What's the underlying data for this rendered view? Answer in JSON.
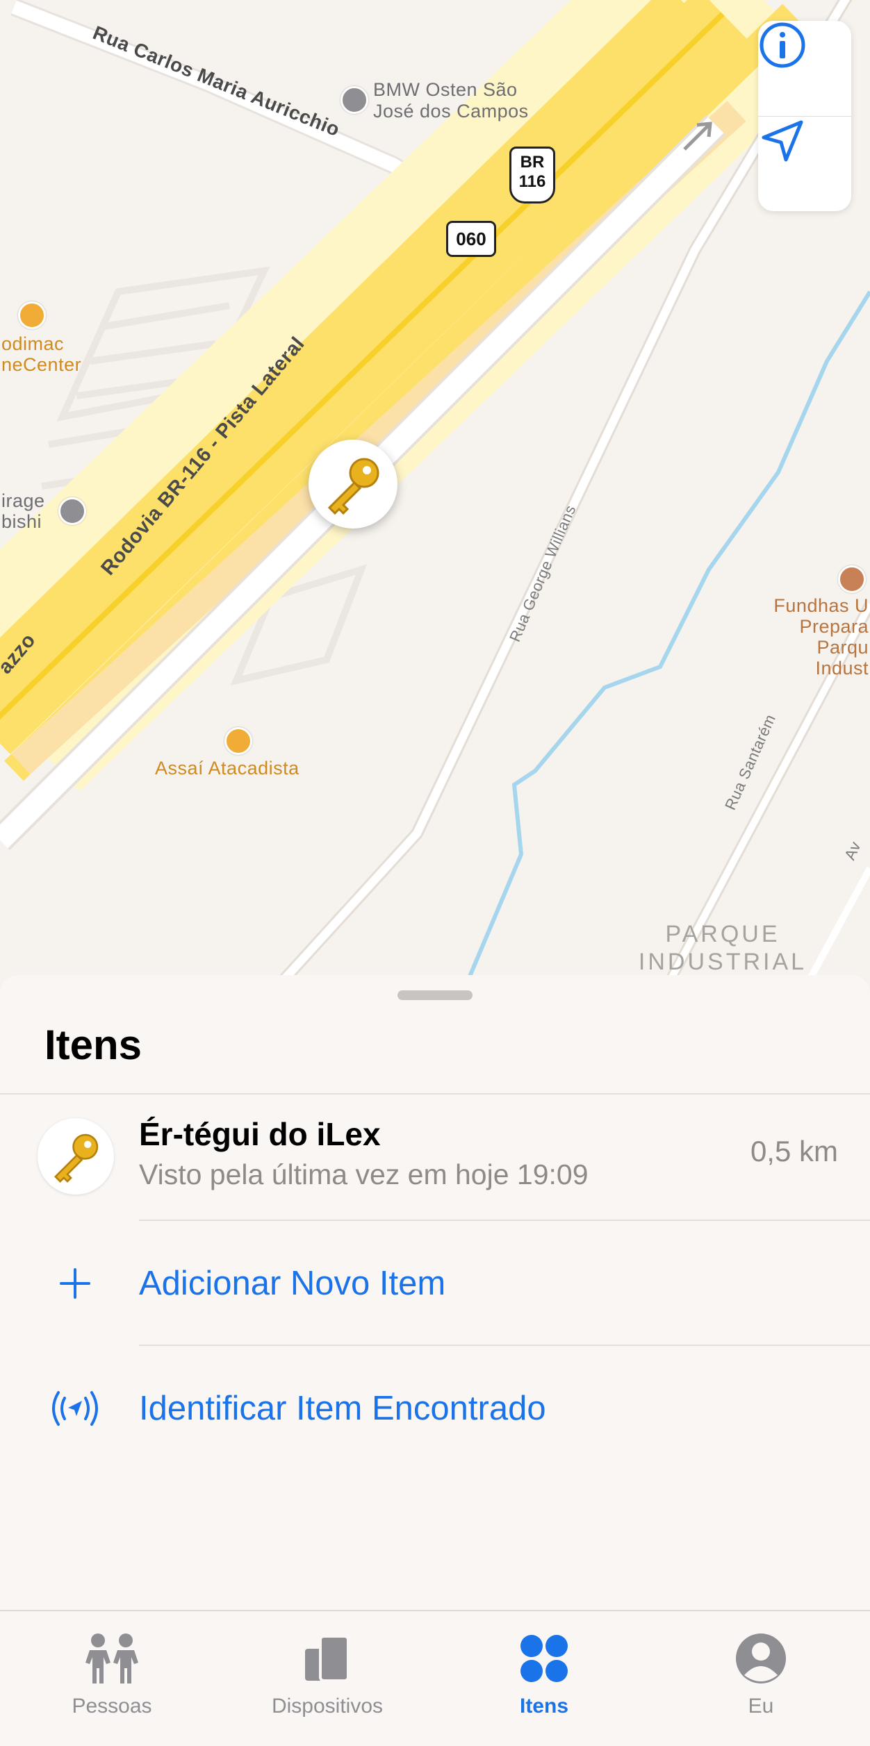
{
  "map": {
    "roads": {
      "rua_carlos": "Rua Carlos Maria Auricchio",
      "rodovia": "Rodovia BR-116 - Pista Lateral",
      "azzo": "azzo",
      "rua_george": "Rua George Willians",
      "rua_santarem": "Rua Santarém",
      "av_partial": "Av"
    },
    "shields": {
      "br_top": "BR",
      "br_num": "116",
      "route": "060"
    },
    "pois": {
      "bmw": "BMW Osten São\nJosé dos Campos",
      "sodimac": "odimac\nneCenter",
      "mirage": "irage\nbishi",
      "assai": "Assaí Atacadista",
      "fundhas": "Fundhas U\nPrepara\nParqu\nIndust"
    },
    "district": "PARQUE\nINDUSTRIAL",
    "controls": {
      "info": "info-icon",
      "locate": "location-arrow-icon"
    },
    "accent": "#1a73e8"
  },
  "sheet": {
    "title": "Itens",
    "item": {
      "name": "Ér-tégui do iLex",
      "subtitle": "Visto pela última vez em hoje 19:09",
      "distance": "0,5 km",
      "icon": "key-icon"
    },
    "actions": [
      {
        "label": "Adicionar Novo Item",
        "icon": "plus-icon"
      },
      {
        "label": "Identificar Item Encontrado",
        "icon": "broadcast-icon"
      }
    ]
  },
  "tabbar": {
    "tabs": [
      {
        "label": "Pessoas",
        "icon": "people-icon",
        "active": false
      },
      {
        "label": "Dispositivos",
        "icon": "devices-icon",
        "active": false
      },
      {
        "label": "Itens",
        "icon": "items-icon",
        "active": true
      },
      {
        "label": "Eu",
        "icon": "person-icon",
        "active": false
      }
    ]
  }
}
